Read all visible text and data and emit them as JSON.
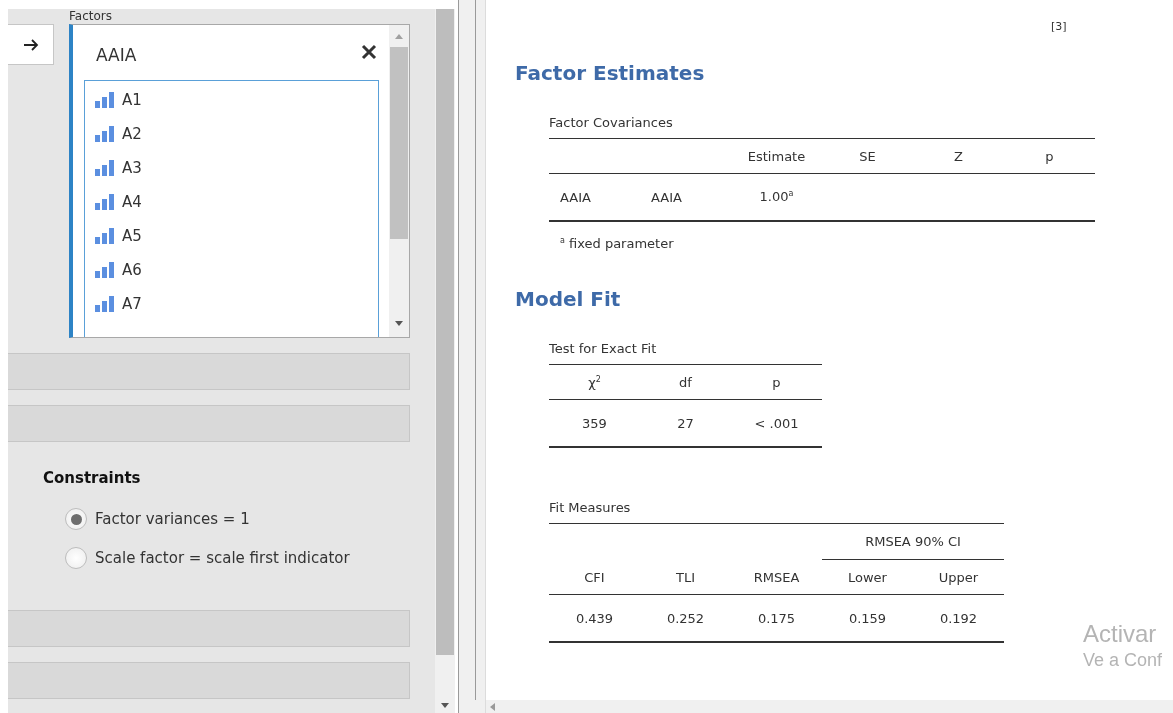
{
  "options_panel": {
    "factors_label": "Factors",
    "factor": {
      "name": "AAIA",
      "variables": [
        "A1",
        "A2",
        "A3",
        "A4",
        "A5",
        "A6",
        "A7"
      ]
    },
    "constraints": {
      "title": "Constraints",
      "options": [
        {
          "label": "Factor variances = 1",
          "selected": true
        },
        {
          "label": "Scale factor = scale first indicator",
          "selected": false
        }
      ]
    }
  },
  "results": {
    "reference": "[3]",
    "sections": [
      {
        "title": "Factor Estimates",
        "tables": [
          {
            "title": "Factor Covariances",
            "columns": [
              "",
              "",
              "Estimate",
              "SE",
              "Z",
              "p"
            ],
            "rows": [
              [
                "AAIA",
                "AAIA",
                "1.00$^{a}$"
              ]
            ],
            "footnote": "$^{a}$ fixed parameter"
          }
        ]
      },
      {
        "title": "Model Fit",
        "tables": [
          {
            "title": "Test for Exact Fit",
            "columns": [
              "χ$^{2}$",
              "df",
              "p"
            ],
            "rows": [
              [
                "359",
                "27",
                "< .001"
              ]
            ]
          },
          {
            "title": "Fit Measures",
            "column_groups": [
              {
                "columns": [
                  "CFI",
                  "TLI",
                  "RMSEA"
                ]
              },
              {
                "label": "RMSEA 90% CI",
                "columns": [
                  "Lower",
                  "Upper"
                ]
              }
            ],
            "rows": [
              [
                "0.439",
                "0.252",
                "0.175",
                "0.159",
                "0.192"
              ]
            ]
          }
        ]
      }
    ]
  },
  "activation_notice": [
    "Activar",
    "Ve a Conf"
  ]
}
